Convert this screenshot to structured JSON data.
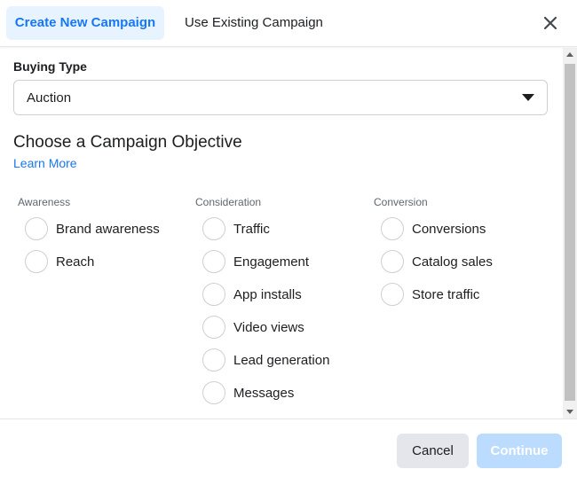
{
  "header": {
    "tabs": [
      {
        "label": "Create New Campaign",
        "active": true
      },
      {
        "label": "Use Existing Campaign",
        "active": false
      }
    ],
    "close_icon": "close-icon"
  },
  "buying_type": {
    "label": "Buying Type",
    "value": "Auction"
  },
  "objective": {
    "title": "Choose a Campaign Objective",
    "learn_more": "Learn More"
  },
  "columns": [
    {
      "header": "Awareness",
      "options": [
        "Brand awareness",
        "Reach"
      ]
    },
    {
      "header": "Consideration",
      "options": [
        "Traffic",
        "Engagement",
        "App installs",
        "Video views",
        "Lead generation",
        "Messages"
      ]
    },
    {
      "header": "Conversion",
      "options": [
        "Conversions",
        "Catalog sales",
        "Store traffic"
      ]
    }
  ],
  "footer": {
    "cancel_label": "Cancel",
    "continue_label": "Continue"
  },
  "colors": {
    "accent": "#1877f2",
    "active_tab_bg": "#e7f3ff",
    "continue_disabled_bg": "#bcdcff"
  }
}
